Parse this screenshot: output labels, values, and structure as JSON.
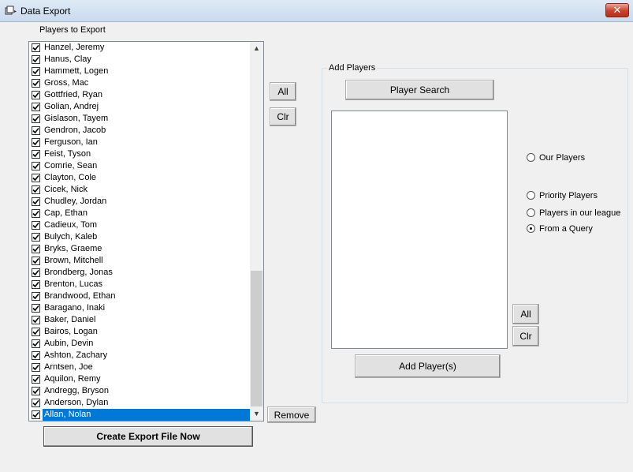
{
  "window": {
    "title": "Data Export",
    "close_label": "✕"
  },
  "players_section": {
    "label": "Players to Export",
    "players": [
      {
        "name": "Hanzel, Jeremy",
        "checked": true
      },
      {
        "name": "Hanus, Clay",
        "checked": true
      },
      {
        "name": "Hammett, Logen",
        "checked": true
      },
      {
        "name": "Gross, Mac",
        "checked": true
      },
      {
        "name": "Gottfried, Ryan",
        "checked": true
      },
      {
        "name": "Golian, Andrej",
        "checked": true
      },
      {
        "name": "Gislason, Tayem",
        "checked": true
      },
      {
        "name": "Gendron, Jacob",
        "checked": true
      },
      {
        "name": "Ferguson, Ian",
        "checked": true
      },
      {
        "name": "Feist, Tyson",
        "checked": true
      },
      {
        "name": "Comrie, Sean",
        "checked": true
      },
      {
        "name": "Clayton, Cole",
        "checked": true
      },
      {
        "name": "Cicek, Nick",
        "checked": true
      },
      {
        "name": "Chudley, Jordan",
        "checked": true
      },
      {
        "name": "Cap, Ethan",
        "checked": true
      },
      {
        "name": "Cadieux, Tom",
        "checked": true
      },
      {
        "name": "Bulych, Kaleb",
        "checked": true
      },
      {
        "name": "Bryks, Graeme",
        "checked": true
      },
      {
        "name": "Brown, Mitchell",
        "checked": true
      },
      {
        "name": "Brondberg, Jonas",
        "checked": true
      },
      {
        "name": "Brenton, Lucas",
        "checked": true
      },
      {
        "name": "Brandwood, Ethan",
        "checked": true
      },
      {
        "name": "Baragano, Inaki",
        "checked": true
      },
      {
        "name": "Baker, Daniel",
        "checked": true
      },
      {
        "name": "Bairos, Logan",
        "checked": true
      },
      {
        "name": "Aubin, Devin",
        "checked": true
      },
      {
        "name": "Ashton, Zachary",
        "checked": true
      },
      {
        "name": "Arntsen, Joe",
        "checked": true
      },
      {
        "name": "Aquilon, Remy",
        "checked": true
      },
      {
        "name": "Andregg, Bryson",
        "checked": true
      },
      {
        "name": "Anderson, Dylan",
        "checked": true
      },
      {
        "name": "Allan, Nolan",
        "checked": true,
        "selected": true
      }
    ],
    "all_label": "All",
    "clr_label": "Clr",
    "remove_label": "Remove",
    "create_label": "Create Export File Now"
  },
  "add_players": {
    "group_label": "Add Players",
    "search_label": "Player Search",
    "add_label": "Add Player(s)",
    "all_label": "All",
    "clr_label": "Clr",
    "radios": [
      {
        "label": "Our Players",
        "checked": false
      },
      {
        "label": "Priority Players",
        "checked": false
      },
      {
        "label": "Players in our league",
        "checked": false
      },
      {
        "label": "From a Query",
        "checked": true
      }
    ]
  }
}
